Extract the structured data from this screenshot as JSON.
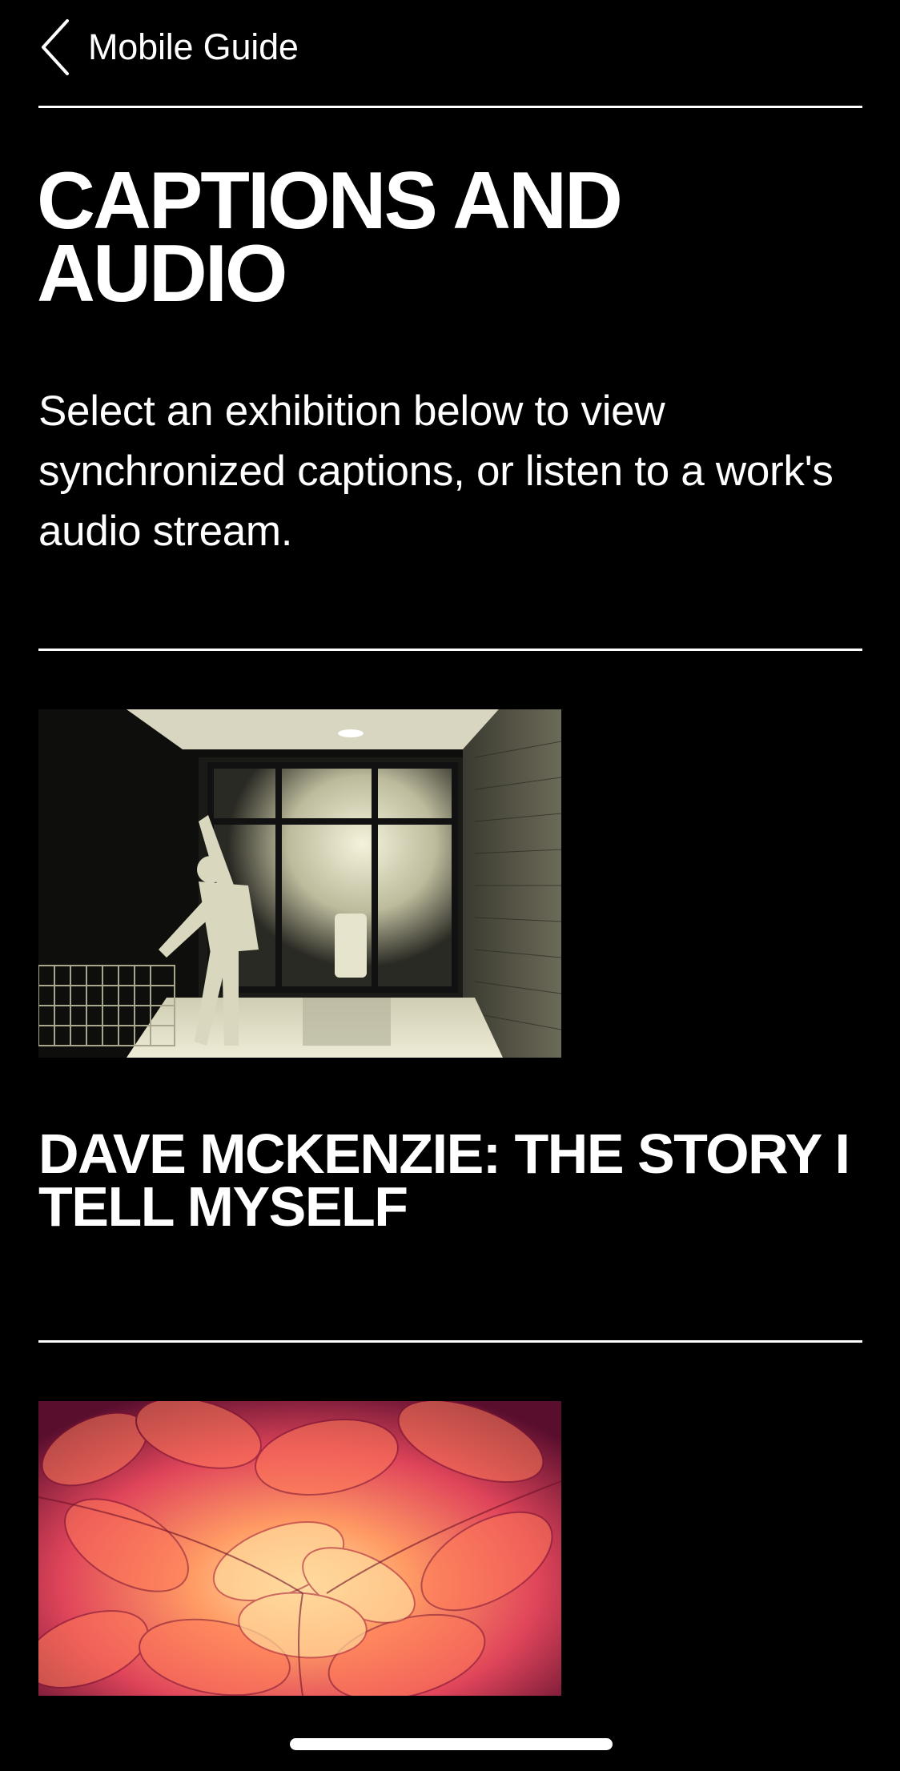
{
  "nav": {
    "back_label": "Mobile Guide",
    "back_icon": "chevron-left-icon"
  },
  "page": {
    "title": "CAPTIONS AND AUDIO",
    "intro": "Select an exhibition below to view synchronized captions, or listen to a work's audio stream."
  },
  "exhibitions": [
    {
      "title": "DAVE MCKENZIE: THE STORY I TELL MYSELF",
      "image": "night-storefront-performer-photo"
    },
    {
      "title": "",
      "image": "red-infrared-foliage-photo"
    }
  ],
  "colors": {
    "background": "#000000",
    "foreground": "#ffffff"
  }
}
